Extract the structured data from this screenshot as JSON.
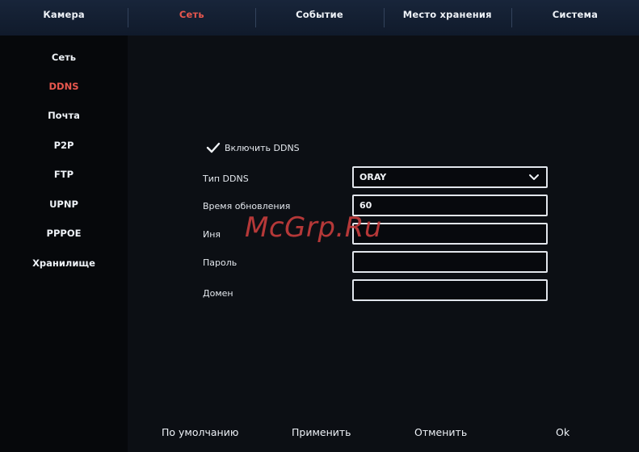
{
  "tabs": [
    {
      "label": "Камера"
    },
    {
      "label": "Сеть"
    },
    {
      "label": "Событие"
    },
    {
      "label": "Место хранения"
    },
    {
      "label": "Система"
    }
  ],
  "sidebar": {
    "items": [
      {
        "label": "Сеть"
      },
      {
        "label": "DDNS"
      },
      {
        "label": "Почта"
      },
      {
        "label": "P2P"
      },
      {
        "label": "FTP"
      },
      {
        "label": "UPNP"
      },
      {
        "label": "PPPOE"
      },
      {
        "label": "Хранилище"
      }
    ]
  },
  "ddns": {
    "enable_label": "Включить DDNS",
    "enabled": true,
    "fields": [
      {
        "label": "Тип DDNS",
        "value": "ORAY"
      },
      {
        "label": "Время обновления",
        "value": "60"
      },
      {
        "label": "Иня",
        "value": ""
      },
      {
        "label": "Пароль",
        "value": ""
      },
      {
        "label": "Домен",
        "value": ""
      }
    ]
  },
  "actions": {
    "default": "По умолчанию",
    "apply": "Применить",
    "cancel": "Отменить",
    "ok": "Ok"
  },
  "watermark": "McGrp.Ru",
  "colors": {
    "accent": "#e8574e",
    "topbar": "#14203a",
    "background": "#07090d"
  },
  "icons": {
    "checkbox": "checkmark-icon",
    "dropdown": "chevron-down-icon"
  }
}
